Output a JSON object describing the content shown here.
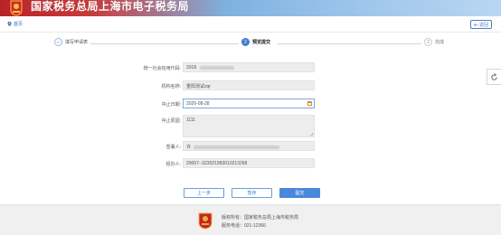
{
  "header": {
    "title": "国家税务总局上海市电子税务局",
    "brand_color": "#c0282d"
  },
  "nav": {
    "home_label": "首页",
    "back_label": "返回"
  },
  "steps": [
    {
      "label": "填写申请表",
      "status": "done"
    },
    {
      "label": "预览提交",
      "number": "2",
      "status": "active"
    },
    {
      "label": "完成",
      "number": "3",
      "status": "todo"
    }
  ],
  "form": {
    "credit_code": {
      "label": "统一社会信用代码:",
      "value": "2018"
    },
    "org_name": {
      "label": "机构名称:",
      "value": "重阳测试zqr"
    },
    "stop_date": {
      "label": "中止日期:",
      "value": "2026-08-28"
    },
    "reason": {
      "label": "中止原因:",
      "value": "1111"
    },
    "issuer": {
      "label": "签署人:",
      "value": "许"
    },
    "operator": {
      "label": "经办人:",
      "value": "20007--323021983010213268"
    }
  },
  "buttons": {
    "prev": "上一步",
    "save": "暂存",
    "submit": "提交"
  },
  "footer": {
    "copyright": "版权所有：国家税务总局上海市税务局",
    "phone": "服务电话：021-12366"
  }
}
